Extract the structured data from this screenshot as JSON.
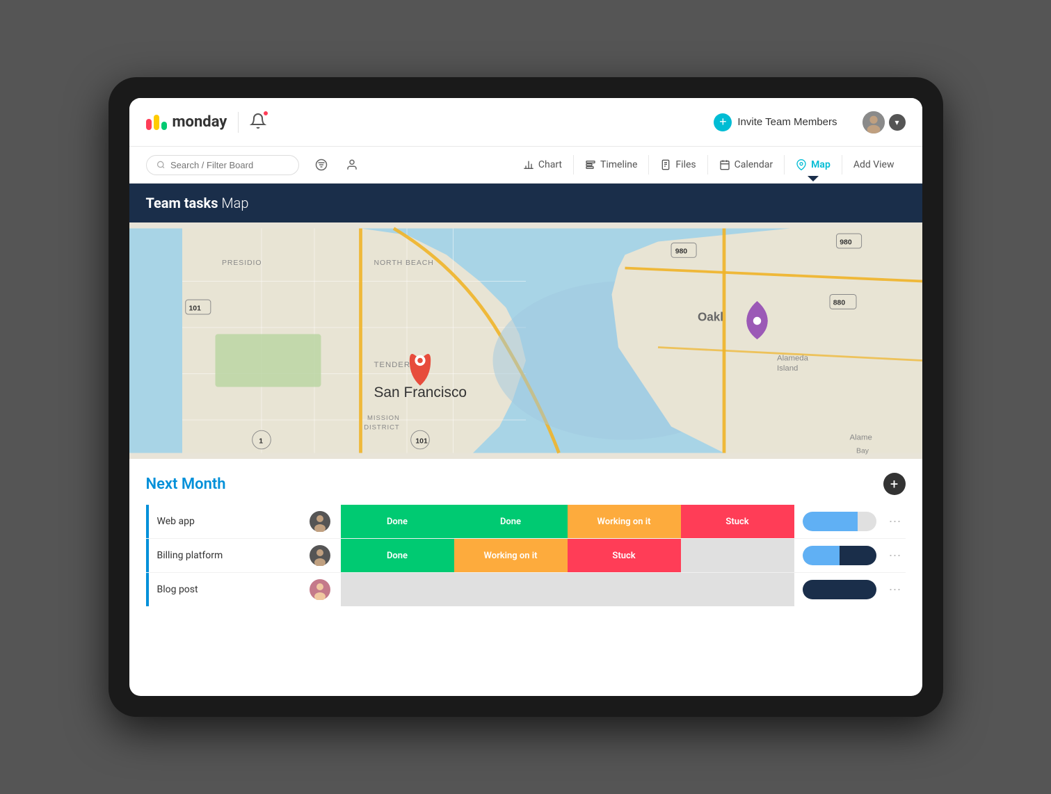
{
  "device": {
    "label": "monitor frame"
  },
  "header": {
    "logo_text": "monday",
    "divider": true,
    "invite_label": "Invite Team Members",
    "invite_plus": "+"
  },
  "toolbar": {
    "search_placeholder": "Search / Filter Board",
    "views": [
      {
        "id": "chart",
        "label": "Chart",
        "active": false
      },
      {
        "id": "timeline",
        "label": "Timeline",
        "active": false
      },
      {
        "id": "files",
        "label": "Files",
        "active": false
      },
      {
        "id": "calendar",
        "label": "Calendar",
        "active": false
      },
      {
        "id": "map",
        "label": "Map",
        "active": true
      },
      {
        "id": "add-view",
        "label": "Add View",
        "active": false
      }
    ]
  },
  "board": {
    "title_bold": "Team tasks",
    "title_light": " Map"
  },
  "map": {
    "location": "San Francisco",
    "marker_lat": 37.7749,
    "marker_lon": -122.4194
  },
  "tasks_section": {
    "title": "Next Month",
    "add_label": "+",
    "rows": [
      {
        "name": "Web app",
        "avatar_type": "man",
        "statuses": [
          {
            "label": "Done",
            "type": "done"
          },
          {
            "label": "Done",
            "type": "done"
          },
          {
            "label": "Working on it",
            "type": "working"
          },
          {
            "label": "Stuck",
            "type": "stuck"
          }
        ],
        "progress": {
          "fill_pct": 75,
          "dark_pct": 0
        }
      },
      {
        "name": "Billing platform",
        "avatar_type": "man",
        "statuses": [
          {
            "label": "Done",
            "type": "done"
          },
          {
            "label": "Working on it",
            "type": "working"
          },
          {
            "label": "Stuck",
            "type": "stuck"
          },
          {
            "label": "",
            "type": "empty"
          }
        ],
        "progress": {
          "fill_pct": 50,
          "dark_pct": 50
        }
      },
      {
        "name": "Blog post",
        "avatar_type": "woman",
        "statuses": [
          {
            "label": "",
            "type": "empty"
          },
          {
            "label": "",
            "type": "empty"
          },
          {
            "label": "",
            "type": "empty"
          },
          {
            "label": "",
            "type": "empty"
          }
        ],
        "progress": {
          "fill_pct": 0,
          "dark_pct": 100
        }
      }
    ]
  },
  "colors": {
    "done": "#00ca72",
    "working": "#fdab3d",
    "stuck": "#ff3d57",
    "empty": "#e0e0e0",
    "active_view": "#00bcd4",
    "board_header": "#1a2e4a",
    "section_title": "#0090d9"
  }
}
